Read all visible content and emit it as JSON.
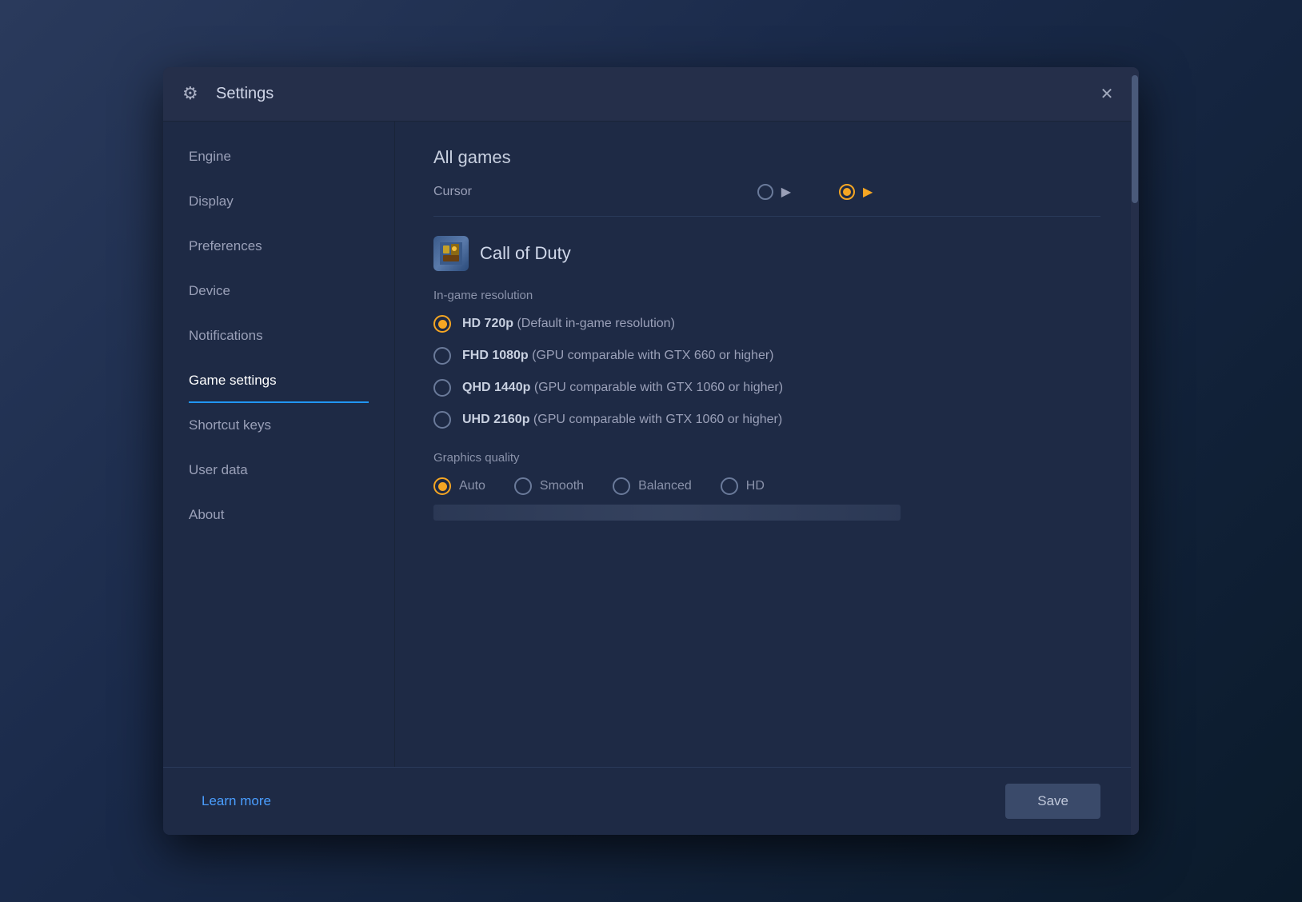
{
  "dialog": {
    "title": "Settings",
    "title_icon": "⚙",
    "close_label": "✕"
  },
  "sidebar": {
    "items": [
      {
        "id": "engine",
        "label": "Engine",
        "active": false
      },
      {
        "id": "display",
        "label": "Display",
        "active": false
      },
      {
        "id": "preferences",
        "label": "Preferences",
        "active": false
      },
      {
        "id": "device",
        "label": "Device",
        "active": false
      },
      {
        "id": "notifications",
        "label": "Notifications",
        "active": false
      },
      {
        "id": "game-settings",
        "label": "Game settings",
        "active": true
      },
      {
        "id": "shortcut-keys",
        "label": "Shortcut keys",
        "active": false
      },
      {
        "id": "user-data",
        "label": "User data",
        "active": false
      },
      {
        "id": "about",
        "label": "About",
        "active": false
      }
    ]
  },
  "main": {
    "all_games_title": "All games",
    "cursor": {
      "label": "Cursor",
      "option_default_selected": false,
      "option_game_selected": true
    },
    "game": {
      "name": "Call of Duty",
      "resolution_title": "In-game resolution",
      "resolutions": [
        {
          "id": "hd720",
          "label": "HD 720p",
          "description": "(Default in-game resolution)",
          "selected": true
        },
        {
          "id": "fhd1080",
          "label": "FHD 1080p",
          "description": "(GPU comparable with GTX 660 or higher)",
          "selected": false
        },
        {
          "id": "qhd1440",
          "label": "QHD 1440p",
          "description": "(GPU comparable with GTX 1060 or higher)",
          "selected": false
        },
        {
          "id": "uhd2160",
          "label": "UHD 2160p",
          "description": "(GPU comparable with GTX 1060 or higher)",
          "selected": false
        }
      ],
      "graphics_quality_title": "Graphics quality",
      "quality_options": [
        {
          "id": "auto",
          "label": "Auto",
          "selected": true
        },
        {
          "id": "smooth",
          "label": "Smooth",
          "selected": false
        },
        {
          "id": "balanced",
          "label": "Balanced",
          "selected": false
        },
        {
          "id": "hd",
          "label": "HD",
          "selected": false
        }
      ]
    }
  },
  "footer": {
    "learn_more": "Learn more",
    "save": "Save"
  }
}
